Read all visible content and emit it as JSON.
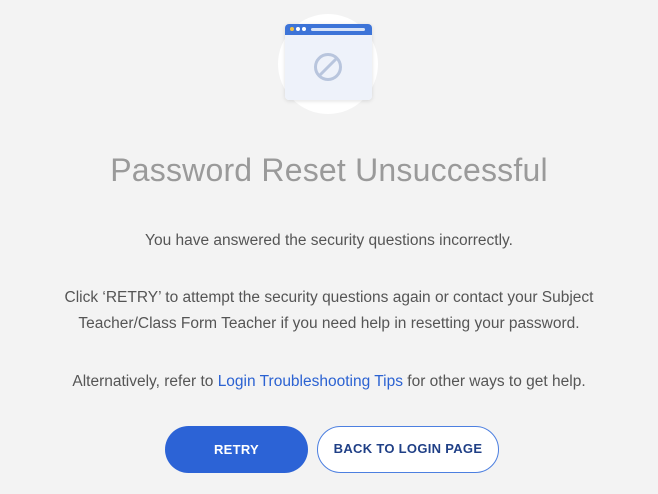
{
  "icon": {
    "illustration": "browser-window-blocked-icon"
  },
  "title": "Password Reset Unsuccessful",
  "message": {
    "line1": "You have answered the security questions incorrectly.",
    "line2a": "Click ‘RETRY’ to attempt the security questions again or contact your Subject",
    "line2b": "Teacher/Class Form Teacher if you need help in resetting your password.",
    "line3_prefix": "Alternatively, refer to ",
    "line3_link": "Login Troubleshooting Tips",
    "line3_suffix": " for other ways to get help."
  },
  "buttons": {
    "retry": "RETRY",
    "back": "BACK TO LOGIN PAGE"
  },
  "colors": {
    "accent": "#2c63d6",
    "link": "#2b62d2",
    "title": "#9a9a9a",
    "background": "#f3f3f3"
  }
}
